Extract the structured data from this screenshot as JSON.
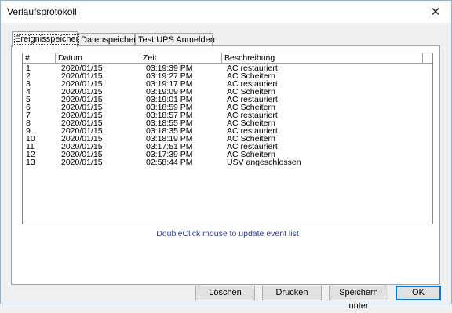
{
  "window": {
    "title": "Verlaufsprotokoll"
  },
  "tabs": [
    {
      "label": "Ereignisspeicher"
    },
    {
      "label": "Datenspeicher"
    },
    {
      "label": "Test UPS Anmelden"
    }
  ],
  "list": {
    "columns": [
      "#",
      "Datum",
      "Zeit",
      "Beschreibung"
    ],
    "rows": [
      {
        "num": "1",
        "date": "2020/01/15",
        "time": "03:19:39 PM",
        "desc": "AC restauriert"
      },
      {
        "num": "2",
        "date": "2020/01/15",
        "time": "03:19:27 PM",
        "desc": "AC Scheitern"
      },
      {
        "num": "3",
        "date": "2020/01/15",
        "time": "03:19:17 PM",
        "desc": "AC restauriert"
      },
      {
        "num": "4",
        "date": "2020/01/15",
        "time": "03:19:09 PM",
        "desc": "AC Scheitern"
      },
      {
        "num": "5",
        "date": "2020/01/15",
        "time": "03:19:01 PM",
        "desc": "AC restauriert"
      },
      {
        "num": "6",
        "date": "2020/01/15",
        "time": "03:18:59 PM",
        "desc": "AC Scheitern"
      },
      {
        "num": "7",
        "date": "2020/01/15",
        "time": "03:18:57 PM",
        "desc": "AC restauriert"
      },
      {
        "num": "8",
        "date": "2020/01/15",
        "time": "03:18:55 PM",
        "desc": "AC Scheitern"
      },
      {
        "num": "9",
        "date": "2020/01/15",
        "time": "03:18:35 PM",
        "desc": "AC restauriert"
      },
      {
        "num": "10",
        "date": "2020/01/15",
        "time": "03:18:19 PM",
        "desc": "AC Scheitern"
      },
      {
        "num": "11",
        "date": "2020/01/15",
        "time": "03:17:51 PM",
        "desc": "AC restauriert"
      },
      {
        "num": "12",
        "date": "2020/01/15",
        "time": "03:17:39 PM",
        "desc": "AC Scheitern"
      },
      {
        "num": "13",
        "date": "2020/01/15",
        "time": "02:58:44 PM",
        "desc": "USV angeschlossen"
      }
    ]
  },
  "hint": "DoubleClick mouse to update event list",
  "buttons": {
    "delete": "Löschen",
    "print": "Drucken",
    "save": "Speichern unter",
    "ok": "OK"
  },
  "icons": {
    "close": "close-icon"
  }
}
